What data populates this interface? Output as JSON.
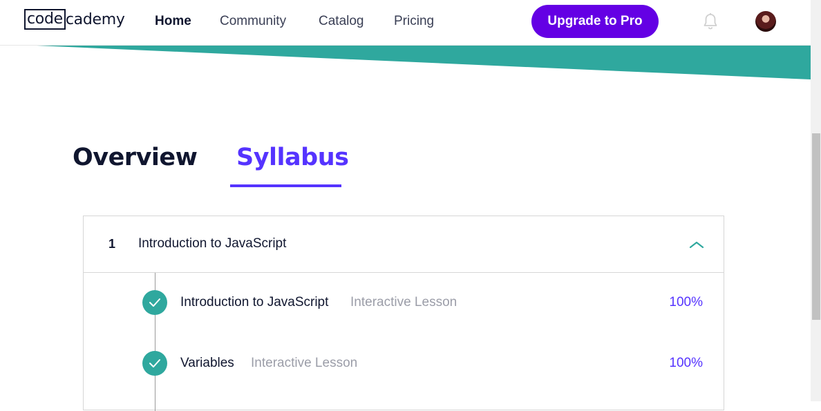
{
  "header": {
    "logo_left": "code",
    "logo_right": "cademy",
    "nav": [
      "Home",
      "Community",
      "Catalog",
      "Pricing"
    ],
    "upgrade_label": "Upgrade to Pro"
  },
  "colors": {
    "brand_purple": "#6400e4",
    "tab_active": "#5533ff",
    "teal": "#2fa89e"
  },
  "tabs": [
    "Overview",
    "Syllabus"
  ],
  "active_tab": "Syllabus",
  "syllabus": {
    "module": {
      "number": "1",
      "title": "Introduction to JavaScript"
    },
    "lessons": [
      {
        "title": "Introduction to JavaScript",
        "type": "Interactive Lesson",
        "progress": "100%"
      },
      {
        "title": "Variables",
        "type": "Interactive Lesson",
        "progress": "100%"
      }
    ]
  }
}
